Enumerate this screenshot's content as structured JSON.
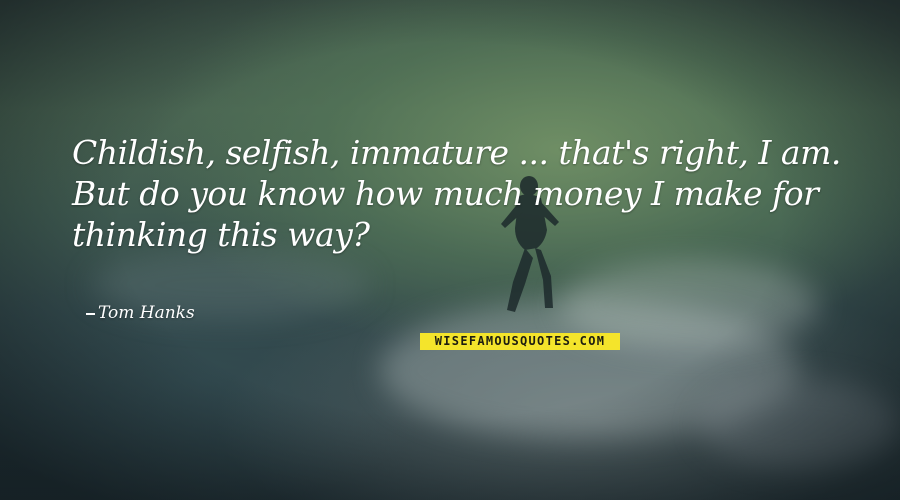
{
  "quote": {
    "text": "Childish, selfish, immature ... that's right, I am. But do you know how much money I make for thinking this way?",
    "author": "Tom Hanks"
  },
  "watermark": {
    "text": "WISEFAMOUSQUOTES.COM"
  },
  "colors": {
    "text": "#ffffff",
    "watermark_bg": "#f4e42b",
    "watermark_text": "#1d1d10",
    "water_dark": "#243338",
    "water_green": "#4b6553"
  }
}
